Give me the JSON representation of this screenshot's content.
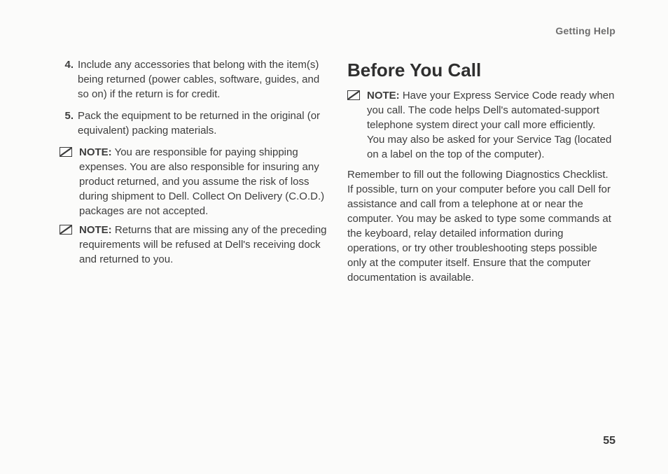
{
  "header": {
    "section": "Getting Help"
  },
  "left": {
    "items": [
      {
        "num": "4.",
        "text": "Include any accessories that belong with the item(s) being returned (power cables, software, guides, and so on) if the return is for credit."
      },
      {
        "num": "5.",
        "text": "Pack the equipment to be returned in the original (or equivalent) packing materials."
      }
    ],
    "notes": [
      {
        "label": "NOTE:",
        "text": " You are responsible for paying shipping expenses. You are also responsible for insuring any product returned, and you assume the risk of loss during shipment to Dell. Collect On Delivery (C.O.D.) packages are not accepted."
      },
      {
        "label": "NOTE:",
        "text": " Returns that are missing any of the preceding requirements will be refused at Dell's receiving dock and returned to you."
      }
    ]
  },
  "right": {
    "heading": "Before You Call",
    "note": {
      "label": "NOTE:",
      "text": " Have your Express Service Code ready when you call. The code helps Dell's automated-support telephone system direct your call more efficiently. You may also be asked for your Service Tag (located on a label on the top of the computer)."
    },
    "paragraph": "Remember to fill out the following Diagnostics Checklist. If possible, turn on your computer before you call Dell for assistance and call from a telephone at or near the computer. You may be asked to type some commands at the keyboard, relay detailed information during operations, or try other troubleshooting steps possible only at the computer itself. Ensure that the computer documentation is available."
  },
  "pageNumber": "55"
}
